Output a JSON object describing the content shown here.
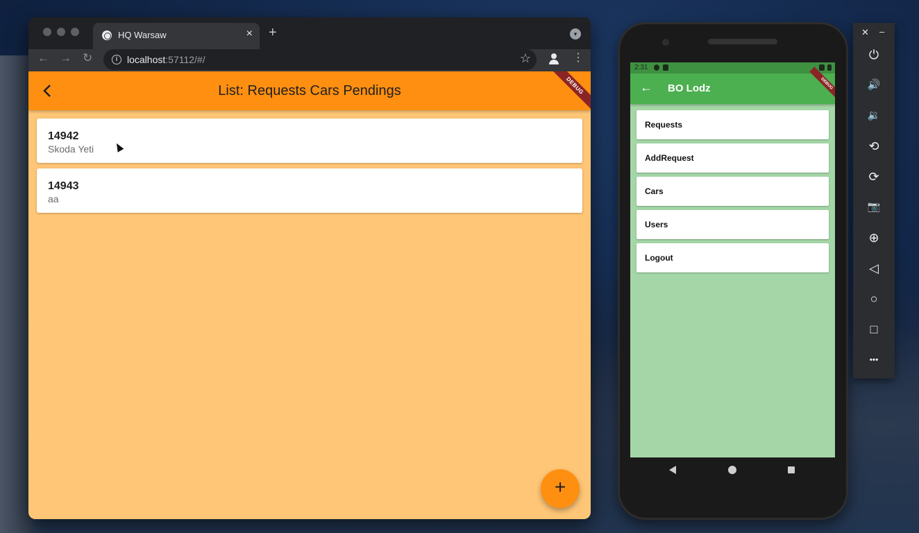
{
  "browser": {
    "tab_title": "HQ Warsaw",
    "tab_close": "×",
    "new_tab": "+",
    "url_host": "localhost",
    "url_rest": ":57112/#/",
    "info_glyph": "i",
    "star_glyph": "☆",
    "kebab_glyph": "⋮",
    "back_glyph": "←",
    "forward_glyph": "→",
    "reload_glyph": "↻",
    "tab_menu_glyph": "▾"
  },
  "web_app": {
    "title": "List: Requests Cars Pendings",
    "debug_banner": "DEBUG",
    "items": [
      {
        "id": "14942",
        "subtitle": "Skoda Yeti"
      },
      {
        "id": "14943",
        "subtitle": "aa"
      }
    ],
    "fab_label": "+",
    "colors": {
      "appbar": "#ff8f10",
      "background": "#ffc677"
    }
  },
  "phone": {
    "status_time": "2:31",
    "title": "BO Lodz",
    "back_glyph": "←",
    "debug_banner": "DEBUG",
    "menu": [
      "Requests",
      "AddRequest",
      "Cars",
      "Users",
      "Logout"
    ],
    "colors": {
      "appbar": "#4caf50",
      "background": "#a5d6a7"
    }
  },
  "emulator": {
    "close": "✕",
    "minimize": "–",
    "buttons": [
      {
        "name": "power-icon",
        "glyph": "⏻"
      },
      {
        "name": "volume-up-icon",
        "glyph": "🔊"
      },
      {
        "name": "volume-down-icon",
        "glyph": "🔉"
      },
      {
        "name": "rotate-left-icon",
        "glyph": "⟲"
      },
      {
        "name": "rotate-right-icon",
        "glyph": "⟳"
      },
      {
        "name": "camera-icon",
        "glyph": "📷"
      },
      {
        "name": "zoom-icon",
        "glyph": "⊕"
      },
      {
        "name": "back-icon",
        "glyph": "◁"
      },
      {
        "name": "home-icon",
        "glyph": "○"
      },
      {
        "name": "overview-icon",
        "glyph": "□"
      },
      {
        "name": "more-icon",
        "glyph": "•••"
      }
    ]
  }
}
